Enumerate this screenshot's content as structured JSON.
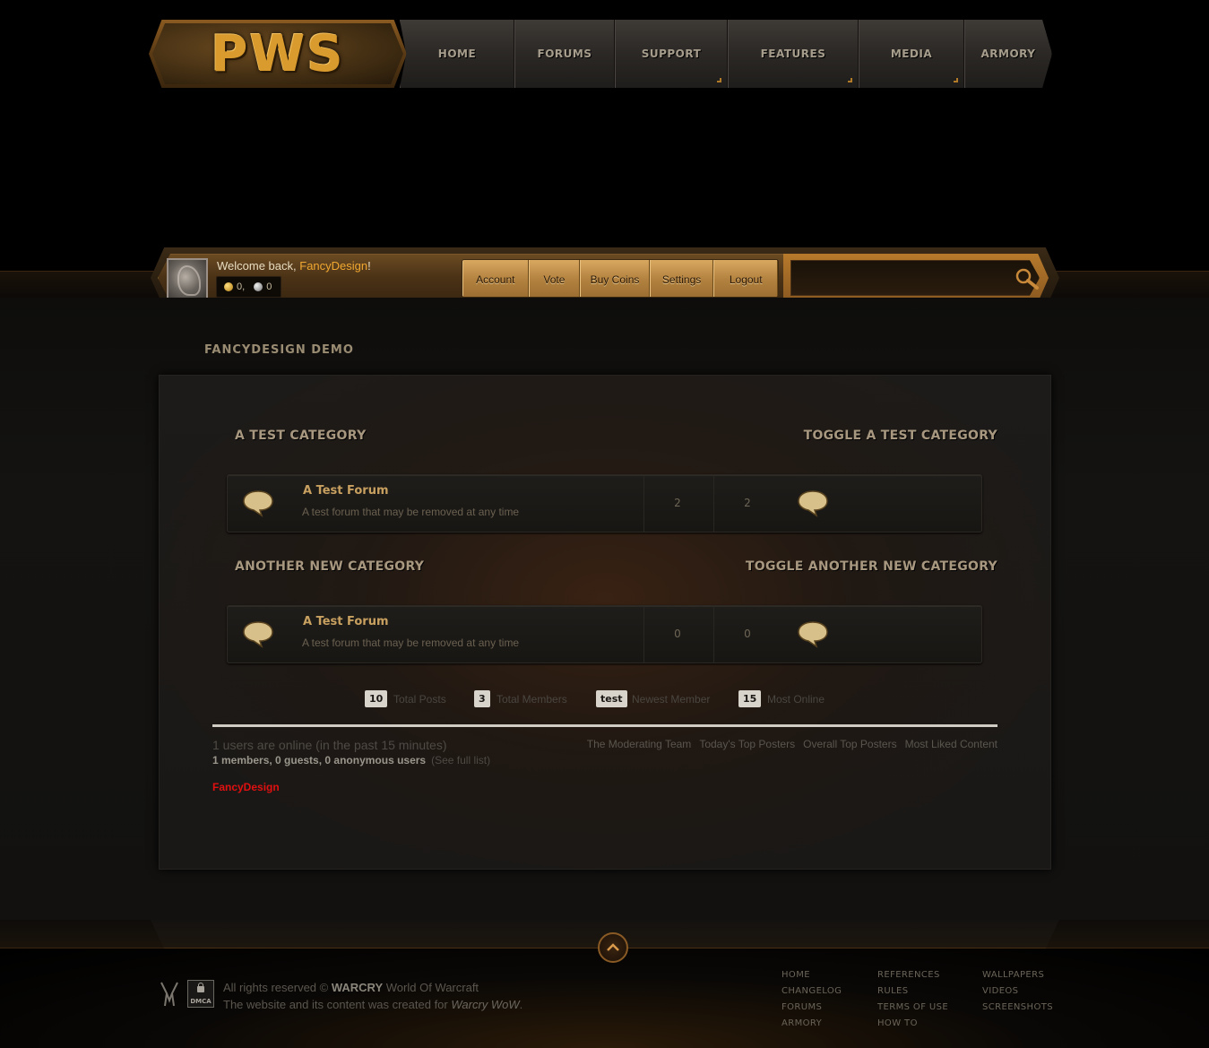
{
  "logo": {
    "text": "PWS"
  },
  "nav": [
    {
      "label": "HOME",
      "dropdown": false
    },
    {
      "label": "FORUMS",
      "dropdown": false
    },
    {
      "label": "SUPPORT",
      "dropdown": true
    },
    {
      "label": "FEATURES",
      "dropdown": true
    },
    {
      "label": "MEDIA",
      "dropdown": true
    },
    {
      "label": "ARMORY",
      "dropdown": false
    }
  ],
  "userbar": {
    "welcome_prefix": "Welcome back, ",
    "username": "FancyDesign",
    "welcome_suffix": "!",
    "gold": "0,",
    "silver": "0",
    "buttons": [
      "Account",
      "Vote",
      "Buy Coins",
      "Settings",
      "Logout"
    ],
    "search_placeholder": ""
  },
  "page": {
    "title": "FANCYDESIGN DEMO"
  },
  "categories": [
    {
      "title": "A TEST CATEGORY",
      "toggle": "TOGGLE A TEST CATEGORY",
      "forum": {
        "name": "A Test Forum",
        "desc": "A test forum that may be removed at any time",
        "topics": "2",
        "posts": "2"
      }
    },
    {
      "title": "ANOTHER NEW CATEGORY",
      "toggle": "TOGGLE ANOTHER NEW CATEGORY",
      "forum": {
        "name": "A Test Forum",
        "desc": "A test forum that may be removed at any time",
        "topics": "0",
        "posts": "0"
      }
    }
  ],
  "stats": [
    {
      "value": "10",
      "label": "Total Posts"
    },
    {
      "value": "3",
      "label": "Total Members"
    },
    {
      "value": "test",
      "label": "Newest Member"
    },
    {
      "value": "15",
      "label": "Most Online"
    }
  ],
  "online": {
    "headline": "1 users are online (in the past 15 minutes)",
    "breakdown": "1 members, 0 guests, 0 anonymous users",
    "full_list": "(See full list)",
    "user": "FancyDesign"
  },
  "quicklinks": [
    "The Moderating Team",
    "Today's Top Posters",
    "Overall Top Posters",
    "Most Liked Content"
  ],
  "footer": {
    "copy_prefix": "All rights reserved © ",
    "brand": "WARCRY",
    "copy_suffix": " World Of Warcraft",
    "line2_prefix": "The website and its content was created for ",
    "line2_em": "Warcry WoW",
    "line2_suffix": ".",
    "dmca": "DMCA",
    "col1": [
      "HOME",
      "CHANGELOG",
      "FORUMS",
      "ARMORY"
    ],
    "col2": [
      "REFERENCES",
      "RULES",
      "TERMS OF USE",
      "HOW TO"
    ],
    "col3": [
      "WALLPAPERS",
      "VIDEOS",
      "SCREENSHOTS"
    ]
  },
  "colors": {
    "accent": "#f0a830",
    "online_user": "#e01010",
    "gold": "#d99a2e"
  }
}
